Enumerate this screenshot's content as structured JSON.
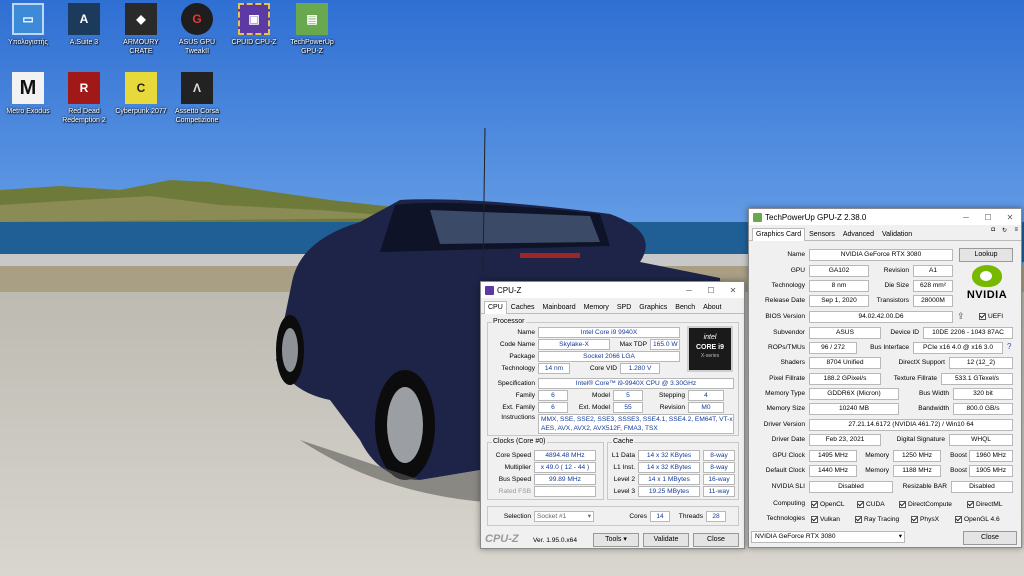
{
  "desktop": {
    "icons": [
      {
        "label": "Υπολογιστής",
        "color": "#3d8ad9"
      },
      {
        "label": "A.Suite 3",
        "color": "#1b3a5c"
      },
      {
        "label": "ARMOURY CRATE",
        "color": "#222"
      },
      {
        "label": "ASUS GPU TweakII",
        "color": "#1e1e1e"
      },
      {
        "label": "CPUID CPU-Z",
        "color": "#5c3aa3"
      },
      {
        "label": "TechPowerUp GPU-Z",
        "color": "#6aa84f"
      },
      {
        "label": "Metro Exodus",
        "color": "#111"
      },
      {
        "label": "Red Dead Redemption 2",
        "color": "#a01818"
      },
      {
        "label": "Cyberpunk 2077",
        "color": "#e8d93a"
      },
      {
        "label": "Assetto Corsa Competizione",
        "color": "#222"
      }
    ]
  },
  "cpuz": {
    "title": "CPU-Z",
    "tabs": [
      "CPU",
      "Caches",
      "Mainboard",
      "Memory",
      "SPD",
      "Graphics",
      "Bench",
      "About"
    ],
    "processor_label": "Processor",
    "name_label": "Name",
    "name": "Intel Core i9 9940X",
    "codename_label": "Code Name",
    "codename": "Skylake-X",
    "maxtdp_label": "Max TDP",
    "maxtdp": "165.0 W",
    "package_label": "Package",
    "package": "Socket 2066 LGA",
    "technology_label": "Technology",
    "technology": "14 nm",
    "corevid_label": "Core VID",
    "corevid": "1.280 V",
    "spec_label": "Specification",
    "spec": "Intel® Core™ i9-9940X CPU @ 3.30GHz",
    "family_label": "Family",
    "family": "6",
    "model_label": "Model",
    "model": "5",
    "stepping_label": "Stepping",
    "stepping": "4",
    "extfamily_label": "Ext. Family",
    "extfamily": "6",
    "extmodel_label": "Ext. Model",
    "extmodel": "55",
    "revision_label": "Revision",
    "revision": "M0",
    "instr_label": "Instructions",
    "instr_line1": "MMX, SSE, SSE2, SSE3, SSSE3, SSE4.1, SSE4.2, EM64T, VT-x,",
    "instr_line2": "AES, AVX, AVX2, AVX512F, FMA3, TSX",
    "logo_line1": "intel",
    "logo_line2": "CORE i9",
    "logo_line3": "X-series",
    "clocks_label": "Clocks (Core #0)",
    "corespeed_label": "Core Speed",
    "corespeed": "4894.48 MHz",
    "multiplier_label": "Multiplier",
    "multiplier": "x 49.0 ( 12 - 44 )",
    "busspeed_label": "Bus Speed",
    "busspeed": "99.89 MHz",
    "ratedfsb_label": "Rated FSB",
    "ratedfsb": "",
    "cache_label": "Cache",
    "l1d_label": "L1 Data",
    "l1d": "14 x 32 KBytes",
    "l1d_way": "8-way",
    "l1i_label": "L1 Inst.",
    "l1i": "14 x 32 KBytes",
    "l1i_way": "8-way",
    "l2_label": "Level 2",
    "l2": "14 x 1 MBytes",
    "l2_way": "16-way",
    "l3_label": "Level 3",
    "l3": "19.25 MBytes",
    "l3_way": "11-way",
    "selection_label": "Selection",
    "selection": "Socket #1",
    "cores_label": "Cores",
    "cores": "14",
    "threads_label": "Threads",
    "threads": "28",
    "brand": "CPU-Z",
    "version": "Ver. 1.95.0.x64",
    "tools": "Tools",
    "validate": "Validate",
    "close": "Close"
  },
  "gpuz": {
    "title": "TechPowerUp GPU-Z 2.38.0",
    "tabs": [
      "Graphics Card",
      "Sensors",
      "Advanced",
      "Validation"
    ],
    "name_label": "Name",
    "name": "NVIDIA GeForce RTX 3080",
    "lookup": "Lookup",
    "gpu_label": "GPU",
    "gpu": "GA102",
    "revision_label": "Revision",
    "revision": "A1",
    "technology_label": "Technology",
    "technology": "8 nm",
    "diesize_label": "Die Size",
    "diesize": "628 mm²",
    "release_label": "Release Date",
    "release": "Sep 1, 2020",
    "transistors_label": "Transistors",
    "transistors": "28000M",
    "bios_label": "BIOS Version",
    "bios": "94.02.42.00.D6",
    "uefi": "UEFI",
    "subvendor_label": "Subvendor",
    "subvendor": "ASUS",
    "deviceid_label": "Device ID",
    "deviceid": "10DE 2206 - 1043 87AC",
    "rops_label": "ROPs/TMUs",
    "rops": "96 / 272",
    "busif_label": "Bus Interface",
    "busif": "PCIe x16 4.0 @ x16 3.0",
    "shaders_label": "Shaders",
    "shaders": "8704 Unified",
    "dx_label": "DirectX Support",
    "dx": "12 (12_2)",
    "pixel_label": "Pixel Fillrate",
    "pixel": "188.2 GPixel/s",
    "texture_label": "Texture Fillrate",
    "texture": "533.1 GTexel/s",
    "memtype_label": "Memory Type",
    "memtype": "GDDR6X (Micron)",
    "buswidth_label": "Bus Width",
    "buswidth": "320 bit",
    "memsize_label": "Memory Size",
    "memsize": "10240 MB",
    "bandwidth_label": "Bandwidth",
    "bandwidth": "800.0 GB/s",
    "driver_label": "Driver Version",
    "driver": "27.21.14.6172 (NVIDIA 461.72) / Win10 64",
    "driverdate_label": "Driver Date",
    "driverdate": "Feb 23, 2021",
    "digsig_label": "Digital Signature",
    "digsig": "WHQL",
    "gpuclock_label": "GPU Clock",
    "gpuclock": "1495 MHz",
    "memory_label": "Memory",
    "memclock": "1250 MHz",
    "boost_label": "Boost",
    "boost": "1960 MHz",
    "defclock_label": "Default Clock",
    "defclock": "1440 MHz",
    "defmem": "1188 MHz",
    "defboost": "1905 MHz",
    "sli_label": "NVIDIA SLI",
    "sli": "Disabled",
    "rebar_label": "Resizable BAR",
    "rebar": "Disabled",
    "computing_label": "Computing",
    "computing": [
      "OpenCL",
      "CUDA",
      "DirectCompute",
      "DirectML"
    ],
    "tech_label": "Technologies",
    "technologies": [
      "Vulkan",
      "Ray Tracing",
      "PhysX",
      "OpenGL 4.6"
    ],
    "logo": "NVIDIA",
    "selected": "NVIDIA GeForce RTX 3080",
    "close": "Close"
  }
}
